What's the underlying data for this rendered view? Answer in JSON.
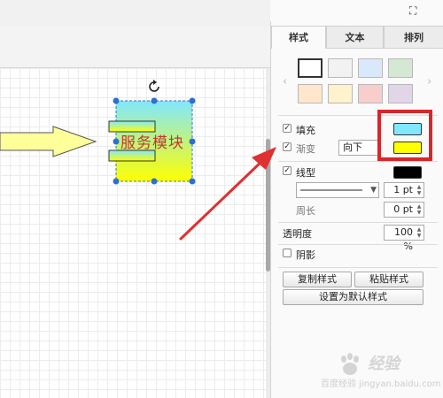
{
  "panel": {
    "tabs": [
      {
        "label": "样式"
      },
      {
        "label": "文本"
      },
      {
        "label": "排列"
      }
    ],
    "swatches": [
      {
        "color": "#ffffff"
      },
      {
        "color": "#f2f2f2"
      },
      {
        "color": "#dae8fc"
      },
      {
        "color": "#d5e8d4"
      },
      {
        "color": "#ffe6cc"
      },
      {
        "color": "#fff2cc"
      },
      {
        "color": "#f8cecc"
      },
      {
        "color": "#e1d5e7"
      }
    ],
    "fill": {
      "label": "填充",
      "checked": true,
      "color": "#80e7ff"
    },
    "gradient": {
      "label": "渐变",
      "checked": true,
      "direction": "向下",
      "color": "#ffff00"
    },
    "line": {
      "label": "线型",
      "checked": true,
      "color": "#000000",
      "width": "1 pt"
    },
    "perimeter": {
      "label": "周长",
      "value": "0 pt"
    },
    "opacity": {
      "label": "透明度",
      "value": "100 %"
    },
    "shadow": {
      "label": "阴影",
      "checked": false
    },
    "buttons": {
      "copy_style": "复制样式",
      "paste_style": "粘贴样式",
      "set_default": "设置为默认样式"
    }
  },
  "canvas": {
    "shape_label": "服务模块",
    "gradient_colors": [
      "#80e7ff",
      "#ffff00"
    ],
    "arrow_color": "#ffff99",
    "annotation_color": "#e03030"
  },
  "watermark": {
    "brand": "经验",
    "sub": "百度经验 jingyan.baidu.com"
  }
}
